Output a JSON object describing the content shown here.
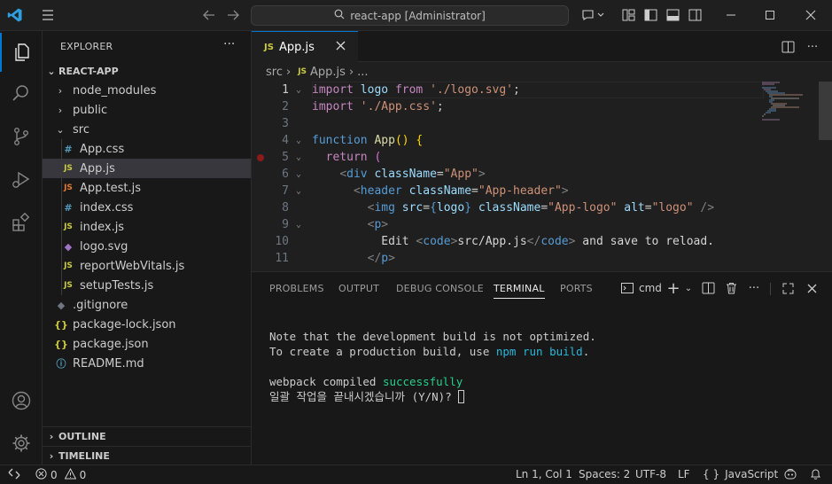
{
  "titlebar": {
    "search_text": "react-app [Administrator]"
  },
  "sidebar": {
    "title": "EXPLORER",
    "more": "···",
    "root": "REACT-APP",
    "items": [
      {
        "label": "node_modules",
        "kind": "folder",
        "expanded": false,
        "depth": 1
      },
      {
        "label": "public",
        "kind": "folder",
        "expanded": false,
        "depth": 1
      },
      {
        "label": "src",
        "kind": "folder",
        "expanded": true,
        "depth": 1
      },
      {
        "label": "App.css",
        "kind": "css",
        "icon": "#",
        "depth": 2
      },
      {
        "label": "App.js",
        "kind": "js",
        "icon": "JS",
        "depth": 2,
        "selected": true
      },
      {
        "label": "App.test.js",
        "kind": "test",
        "icon": "JS",
        "depth": 2
      },
      {
        "label": "index.css",
        "kind": "css",
        "icon": "#",
        "depth": 2
      },
      {
        "label": "index.js",
        "kind": "js",
        "icon": "JS",
        "depth": 2
      },
      {
        "label": "logo.svg",
        "kind": "svg",
        "icon": "◆",
        "depth": 2
      },
      {
        "label": "reportWebVitals.js",
        "kind": "js",
        "icon": "JS",
        "depth": 2
      },
      {
        "label": "setupTests.js",
        "kind": "js",
        "icon": "JS",
        "depth": 2
      },
      {
        "label": ".gitignore",
        "kind": "git",
        "icon": "◆",
        "depth": 1
      },
      {
        "label": "package-lock.json",
        "kind": "json",
        "icon": "{}",
        "depth": 1
      },
      {
        "label": "package.json",
        "kind": "json",
        "icon": "{}",
        "depth": 1
      },
      {
        "label": "README.md",
        "kind": "md",
        "icon": "ⓘ",
        "depth": 1
      }
    ],
    "outline": "OUTLINE",
    "timeline": "TIMELINE"
  },
  "editor": {
    "tab": {
      "icon": "JS",
      "label": "App.js"
    },
    "breadcrumb": [
      "src",
      "App.js",
      "..."
    ],
    "lines": [
      {
        "n": "1"
      },
      {
        "n": "2"
      },
      {
        "n": "3"
      },
      {
        "n": "4"
      },
      {
        "n": "5"
      },
      {
        "n": "6"
      },
      {
        "n": "7"
      },
      {
        "n": "8"
      },
      {
        "n": "9"
      },
      {
        "n": "10"
      },
      {
        "n": "11"
      }
    ]
  },
  "panel": {
    "tabs": [
      "PROBLEMS",
      "OUTPUT",
      "DEBUG CONSOLE",
      "TERMINAL",
      "PORTS"
    ],
    "active_tab": "TERMINAL",
    "terminal_name": "cmd",
    "terminal": {
      "line1": "Note that the development build is not optimized.",
      "line2_a": "To create a production build, use ",
      "line2_b": "npm run build",
      "line2_c": ".",
      "line3_a": "webpack compiled ",
      "line3_b": "successfully",
      "line4": "일괄 작업을 끝내시겠습니까 (Y/N)? "
    }
  },
  "statusbar": {
    "errors": "0",
    "warnings": "0",
    "position": "Ln 1, Col 1",
    "spaces": "Spaces: 2",
    "encoding": "UTF-8",
    "eol": "LF",
    "language": "JavaScript"
  },
  "colors": {
    "accent": "#0078d4",
    "js": "#cbcb41",
    "css": "#519aba",
    "svg": "#a074c4",
    "json": "#cbcb41",
    "test": "#e37933",
    "success": "#23d18b",
    "npm": "#29b8db"
  }
}
